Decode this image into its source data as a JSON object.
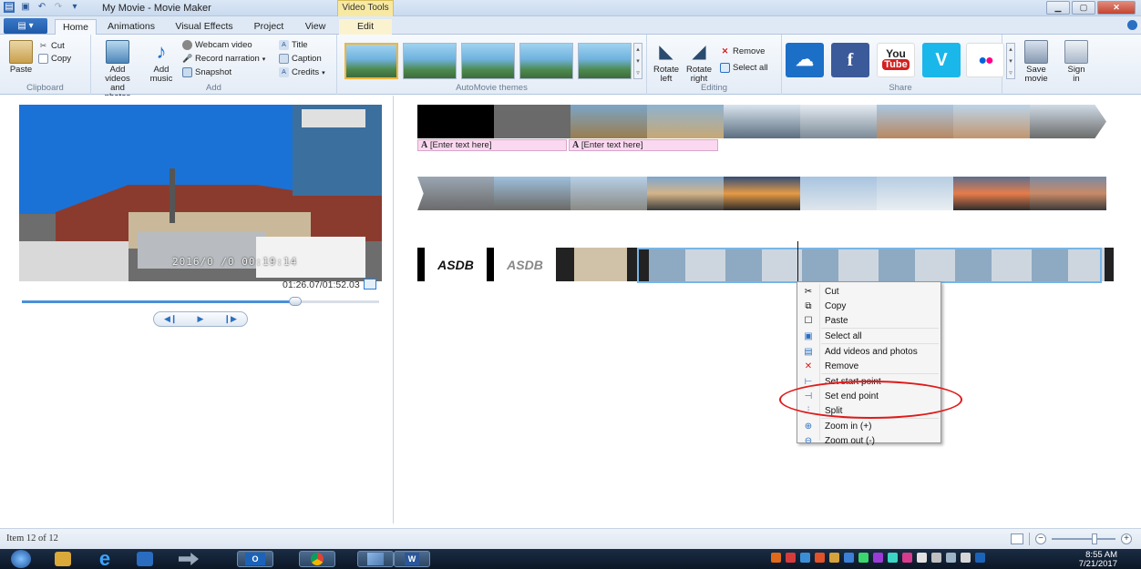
{
  "window": {
    "title": "My Movie - Movie Maker",
    "contextual_tab": "Video Tools"
  },
  "ribbon_tabs": {
    "file": "",
    "items": [
      "Home",
      "Animations",
      "Visual Effects",
      "Project",
      "View",
      "Edit"
    ],
    "active": "Home"
  },
  "clipboard": {
    "paste": "Paste",
    "cut": "Cut",
    "copy": "Copy",
    "group_label": "Clipboard"
  },
  "add": {
    "add_videos_line1": "Add videos",
    "add_videos_line2": "and photos",
    "add_music_line1": "Add",
    "add_music_line2": "music",
    "webcam": "Webcam video",
    "narration": "Record narration",
    "snapshot": "Snapshot",
    "title": "Title",
    "caption": "Caption",
    "credits": "Credits",
    "group_label": "Add"
  },
  "themes": {
    "group_label": "AutoMovie themes"
  },
  "editing": {
    "rotate_left_line1": "Rotate",
    "rotate_left_line2": "left",
    "rotate_right_line1": "Rotate",
    "rotate_right_line2": "right",
    "remove": "Remove",
    "select_all": "Select all",
    "group_label": "Editing"
  },
  "share": {
    "group_label": "Share",
    "youtube_top": "You",
    "youtube_bottom": "Tube",
    "save_movie_line1": "Save",
    "save_movie_line2": "movie",
    "sign_in_line1": "Sign",
    "sign_in_line2": "in"
  },
  "preview": {
    "overlay_time": "2016/0 /0 00:19:14",
    "timecode": "01:26.07/01:52.03",
    "seek_fraction": 0.766
  },
  "storyboard": {
    "caption_1": "[Enter text here]",
    "caption_2": "[Enter text here]",
    "logo_text": "ASDB"
  },
  "context_menu": {
    "items": [
      {
        "label": "Cut",
        "icon": "scissors-icon"
      },
      {
        "label": "Copy",
        "icon": "copy-icon"
      },
      {
        "label": "Paste",
        "icon": "paste-icon"
      },
      {
        "label": "Select all",
        "icon": "select-all-icon"
      },
      {
        "label": "Add videos and photos",
        "icon": "add-media-icon"
      },
      {
        "label": "Remove",
        "icon": "remove-icon"
      },
      {
        "label": "Set start point",
        "icon": "start-point-icon"
      },
      {
        "label": "Set end point",
        "icon": "end-point-icon"
      },
      {
        "label": "Split",
        "icon": "split-icon"
      },
      {
        "label": "Zoom in (+)",
        "icon": "zoom-in-icon"
      },
      {
        "label": "Zoom out (-)",
        "icon": "zoom-out-icon"
      }
    ]
  },
  "status": {
    "item_text": "Item 12 of 12"
  },
  "taskbar": {
    "time": "8:55 AM",
    "date": "7/21/2017"
  },
  "colors": {
    "accent": "#2b6fc2",
    "selection_border": "#78b6e6",
    "annotation_red": "#e01a1a",
    "caption_pink": "#fad9f0"
  }
}
